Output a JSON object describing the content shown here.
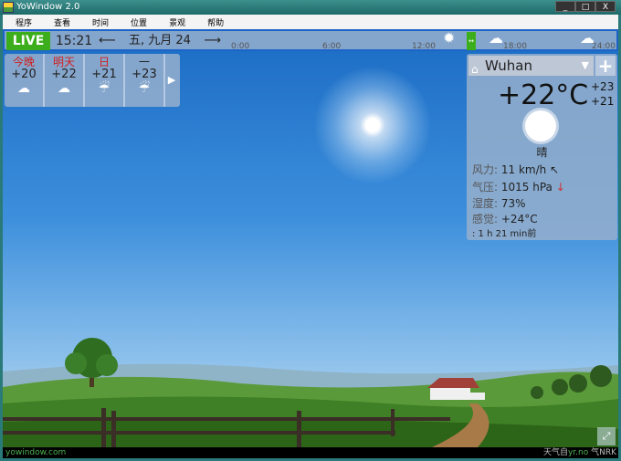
{
  "window": {
    "title": "YoWindow 2.0",
    "controls": [
      "_",
      "□",
      "X"
    ]
  },
  "menu": [
    "程序",
    "查看",
    "时间",
    "位置",
    "景观",
    "帮助"
  ],
  "timebar": {
    "live": "LIVE",
    "time": "15:21",
    "prev": "⟵",
    "date": "五, 九月 24",
    "next": "⟶",
    "ticks": [
      "0:00",
      "6:00",
      "12:00",
      "18:00",
      "24:00"
    ],
    "now_marker": "↔"
  },
  "forecast": {
    "days": [
      {
        "name": "今晚",
        "temp": "+20",
        "icon": "cloud-icon",
        "red": true
      },
      {
        "name": "明天",
        "temp": "+22",
        "icon": "cloud-icon",
        "red": true
      },
      {
        "name": "日",
        "temp": "+21",
        "icon": "rain-cloud-icon",
        "red": true
      },
      {
        "name": "一",
        "temp": "+23",
        "icon": "rain-cloud-icon",
        "red": false
      }
    ],
    "next": "▶"
  },
  "current": {
    "city": "Wuhan",
    "dropdown": "▼",
    "add": "+",
    "temp": "+22°C",
    "high": "+23",
    "low": "+21",
    "condition": "晴",
    "wind_label": "风力:",
    "wind": "11 km/h",
    "wind_arrow": "↖",
    "pressure_label": "气压:",
    "pressure": "1015 hPa",
    "pressure_arrow": "↓",
    "humidity_label": "湿度:",
    "humidity": "73%",
    "feels_label": "感觉:",
    "feels": "+24°C",
    "updated": ": 1 h 21 min前"
  },
  "footer": {
    "site": "yowindow.com",
    "credit_prefix": "天气自",
    "credit_source": "yr.no",
    "credit_suffix": " 气NRK"
  },
  "colors": {
    "live": "#3cae1c",
    "accent": "#1e64c8"
  }
}
